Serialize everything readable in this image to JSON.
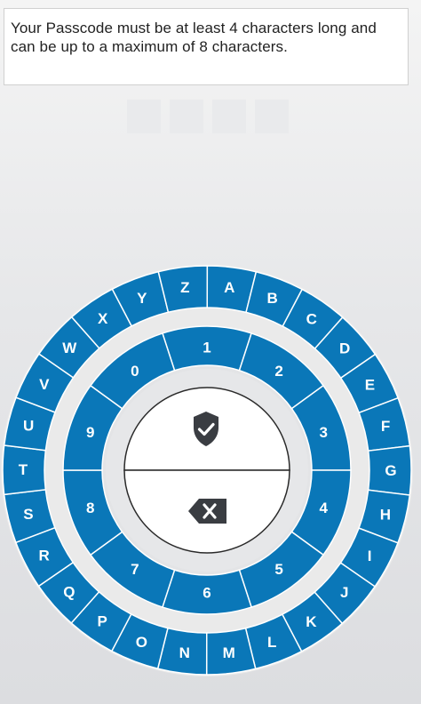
{
  "instructions": {
    "line1": "Your Passcode must be at least 4 characters long and",
    "line2": "can be up to a maximum of 8 characters."
  },
  "passcode": {
    "slots": 4,
    "entered": 0
  },
  "keypad": {
    "letters": [
      "A",
      "B",
      "C",
      "D",
      "E",
      "F",
      "G",
      "H",
      "I",
      "J",
      "K",
      "L",
      "M",
      "N",
      "O",
      "P",
      "Q",
      "R",
      "S",
      "T",
      "U",
      "V",
      "W",
      "X",
      "Y",
      "Z"
    ],
    "digits": [
      "1",
      "2",
      "3",
      "4",
      "5",
      "6",
      "7",
      "8",
      "9",
      "0"
    ]
  },
  "buttons": {
    "confirm_icon": "shield-check-icon",
    "delete_icon": "backspace-icon"
  },
  "colors": {
    "accent_blue": "#0a77b8",
    "ring_gap": "#eaeaea",
    "center": "#ffffff",
    "text": "#ffffff"
  }
}
